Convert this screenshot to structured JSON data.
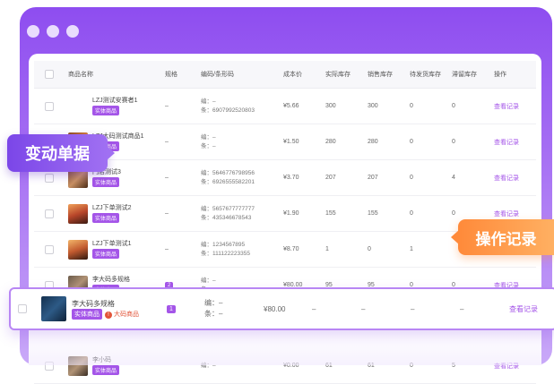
{
  "colors": {
    "accent": "#a455e8",
    "frame": "#8e4df0",
    "orange": "#ff8a3a"
  },
  "columns": [
    "商品名称",
    "规格",
    "编码/条形码",
    "成本价",
    "实际库存",
    "销售库存",
    "待发货库存",
    "滞留库存",
    "操作"
  ],
  "rows": [
    {
      "thumb": "t1",
      "name": "LZJ测试安赛者1",
      "tag": "实体商品",
      "spec": "–",
      "code1": "编：–",
      "code2": "条：6907992520803",
      "cost": "¥5.66",
      "actual": "300",
      "sale": "300",
      "pending": "0",
      "stuck": "0",
      "op": "查看记录"
    },
    {
      "thumb": "t2",
      "name": "LZJ大码测试商品1",
      "tag": "实体商品",
      "spec": "–",
      "code1": "编：–",
      "code2": "条：–",
      "cost": "¥1.50",
      "actual": "280",
      "sale": "280",
      "pending": "0",
      "stuck": "0",
      "op": "查看记录"
    },
    {
      "thumb": "t3",
      "name": "门店测试3",
      "tag": "实体商品",
      "spec": "–",
      "code1": "编：5646776798956",
      "code2": "条：6926555582201",
      "cost": "¥3.70",
      "actual": "207",
      "sale": "207",
      "pending": "0",
      "stuck": "4",
      "op": "查看记录"
    },
    {
      "thumb": "t4",
      "name": "LZJ下单测试2",
      "tag": "实体商品",
      "spec": "–",
      "code1": "编：5657677777777",
      "code2": "条：435346678543",
      "cost": "¥1.90",
      "actual": "155",
      "sale": "155",
      "pending": "0",
      "stuck": "0",
      "op": "查看记录"
    },
    {
      "thumb": "t5",
      "name": "LZJ下单测试1",
      "tag": "实体商品",
      "spec": "–",
      "code1": "编：1234567895",
      "code2": "条：111122223355",
      "cost": "¥8.70",
      "actual": "1",
      "sale": "0",
      "pending": "1",
      "stuck": "",
      "op": ""
    },
    {
      "thumb": "t6",
      "name": "李大码多规格",
      "tag": "实体商品",
      "spec": "2",
      "code1": "编：–",
      "code2": "条：–",
      "cost": "¥80.00",
      "actual": "95",
      "sale": "95",
      "pending": "0",
      "stuck": "0",
      "op": "查看记录"
    }
  ],
  "highlight": {
    "name": "李大码多规格",
    "tag": "实体商品",
    "tag2": "大码商品",
    "spec": "1",
    "code1": "编：–",
    "code2": "条：–",
    "cost": "¥80.00",
    "d1": "–",
    "d2": "–",
    "d3": "–",
    "d4": "–",
    "op": "查看记录"
  },
  "last_row": {
    "name": "李小码",
    "tag": "实体商品",
    "code1": "编：–",
    "cost": "¥0.00",
    "actual": "61",
    "sale": "61",
    "pending": "0",
    "stuck": "5",
    "op": "查看记录"
  },
  "float_left": "变动单据",
  "float_right": "操作记录"
}
